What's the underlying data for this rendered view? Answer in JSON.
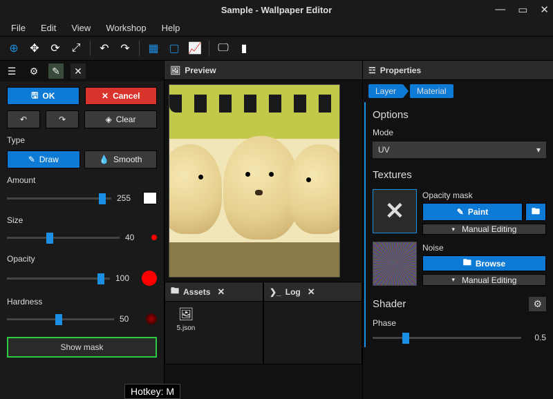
{
  "window": {
    "title": "Sample - Wallpaper Editor"
  },
  "menu": {
    "file": "File",
    "edit": "Edit",
    "view": "View",
    "workshop": "Workshop",
    "help": "Help"
  },
  "left": {
    "ok": "OK",
    "cancel": "Cancel",
    "clear": "Clear",
    "type": "Type",
    "draw": "Draw",
    "smooth": "Smooth",
    "amount": "Amount",
    "amount_val": "255",
    "size": "Size",
    "size_val": "40",
    "opacity": "Opacity",
    "opacity_val": "100",
    "hardness": "Hardness",
    "hardness_val": "50",
    "showmask": "Show mask"
  },
  "mid": {
    "preview": "Preview",
    "assets": "Assets",
    "log": "Log",
    "asset_name": "5.json"
  },
  "right": {
    "properties": "Properties",
    "crumb_layer": "Layer",
    "crumb_material": "Material",
    "options": "Options",
    "mode": "Mode",
    "mode_val": "UV",
    "textures": "Textures",
    "opacity_mask": "Opacity mask",
    "paint": "Paint",
    "manual": "Manual Editing",
    "noise": "Noise",
    "browse": "Browse",
    "shader": "Shader",
    "phase": "Phase",
    "phase_val": "0.5"
  },
  "hotkey": "Hotkey: M"
}
